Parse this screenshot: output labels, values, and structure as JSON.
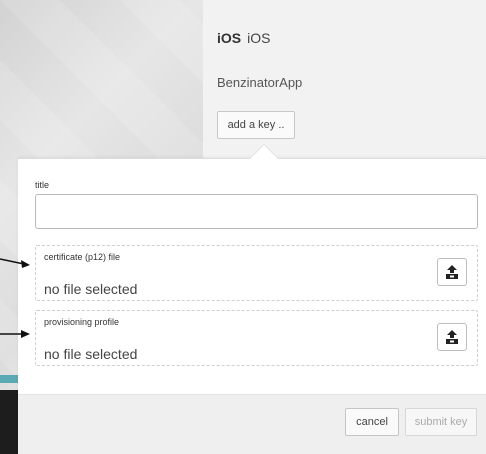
{
  "app": {
    "platform_label": "iOS",
    "platform_sub": "iOS",
    "name": "BenzinatorApp",
    "add_key_label": "add a key .."
  },
  "form": {
    "title_label": "title",
    "title_value": "",
    "certificate": {
      "label": "certificate (p12) file",
      "status": "no file selected",
      "icon": "upload-icon"
    },
    "provisioning": {
      "label": "provisioning profile",
      "status": "no file selected",
      "icon": "upload-icon"
    }
  },
  "actions": {
    "cancel_label": "cancel",
    "submit_label": "submit key"
  },
  "colors": {
    "accent_strip": "#5aa9b4",
    "dark_strip": "#1d1d1d"
  }
}
